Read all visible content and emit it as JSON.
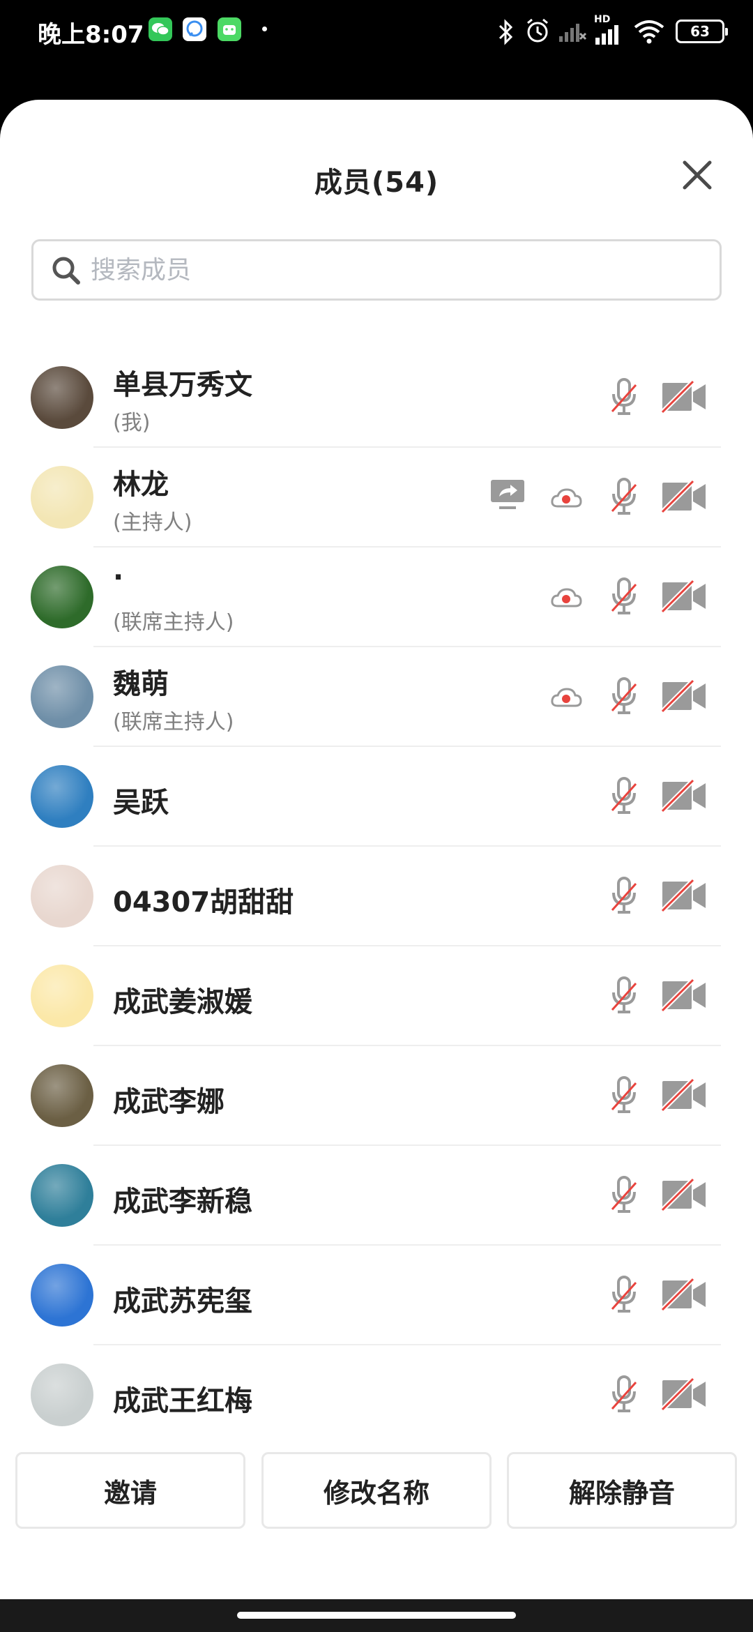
{
  "status_bar": {
    "time": "晚上8:07",
    "battery": "63",
    "hd_label": "HD",
    "icons": [
      "wechat-icon",
      "chat-icon",
      "app-icon",
      "bluetooth-icon",
      "alarm-icon",
      "signal-x-icon",
      "signal-icon",
      "wifi-icon",
      "battery-icon"
    ]
  },
  "header": {
    "title": "成员(54)"
  },
  "search": {
    "placeholder": "搜索成员"
  },
  "members": [
    {
      "name": "单县万秀文",
      "role": "(我)",
      "avatar_color": "#5a4a3c",
      "screen_share": false,
      "recording": false
    },
    {
      "name": "林龙",
      "role": "(主持人)",
      "avatar_color": "#f3e6b4",
      "screen_share": true,
      "recording": true
    },
    {
      "name": "·",
      "role": "(联席主持人)",
      "avatar_color": "#2e6b2a",
      "screen_share": false,
      "recording": true
    },
    {
      "name": "魏萌",
      "role": "(联席主持人)",
      "avatar_color": "#6f8fa8",
      "screen_share": false,
      "recording": true
    },
    {
      "name": "吴跃",
      "role": "",
      "avatar_color": "#2f7fc0",
      "screen_share": false,
      "recording": false
    },
    {
      "name": "04307胡甜甜",
      "role": "",
      "avatar_color": "#e8d7cf",
      "screen_share": false,
      "recording": false
    },
    {
      "name": "成武姜淑媛",
      "role": "",
      "avatar_color": "#fbe8a8",
      "screen_share": false,
      "recording": false
    },
    {
      "name": "成武李娜",
      "role": "",
      "avatar_color": "#6b5f44",
      "screen_share": false,
      "recording": false
    },
    {
      "name": "成武李新稳",
      "role": "",
      "avatar_color": "#2f7f9a",
      "screen_share": false,
      "recording": false
    },
    {
      "name": "成武苏宪玺",
      "role": "",
      "avatar_color": "#2d74d4",
      "screen_share": false,
      "recording": false
    },
    {
      "name": "成武王红梅",
      "role": "",
      "avatar_color": "#c9cfcf",
      "screen_share": false,
      "recording": false
    }
  ],
  "footer": {
    "invite_label": "邀请",
    "rename_label": "修改名称",
    "unmute_label": "解除静音"
  },
  "colors": {
    "accent_red": "#e8433d",
    "icon_gray": "#9a9a9a"
  }
}
